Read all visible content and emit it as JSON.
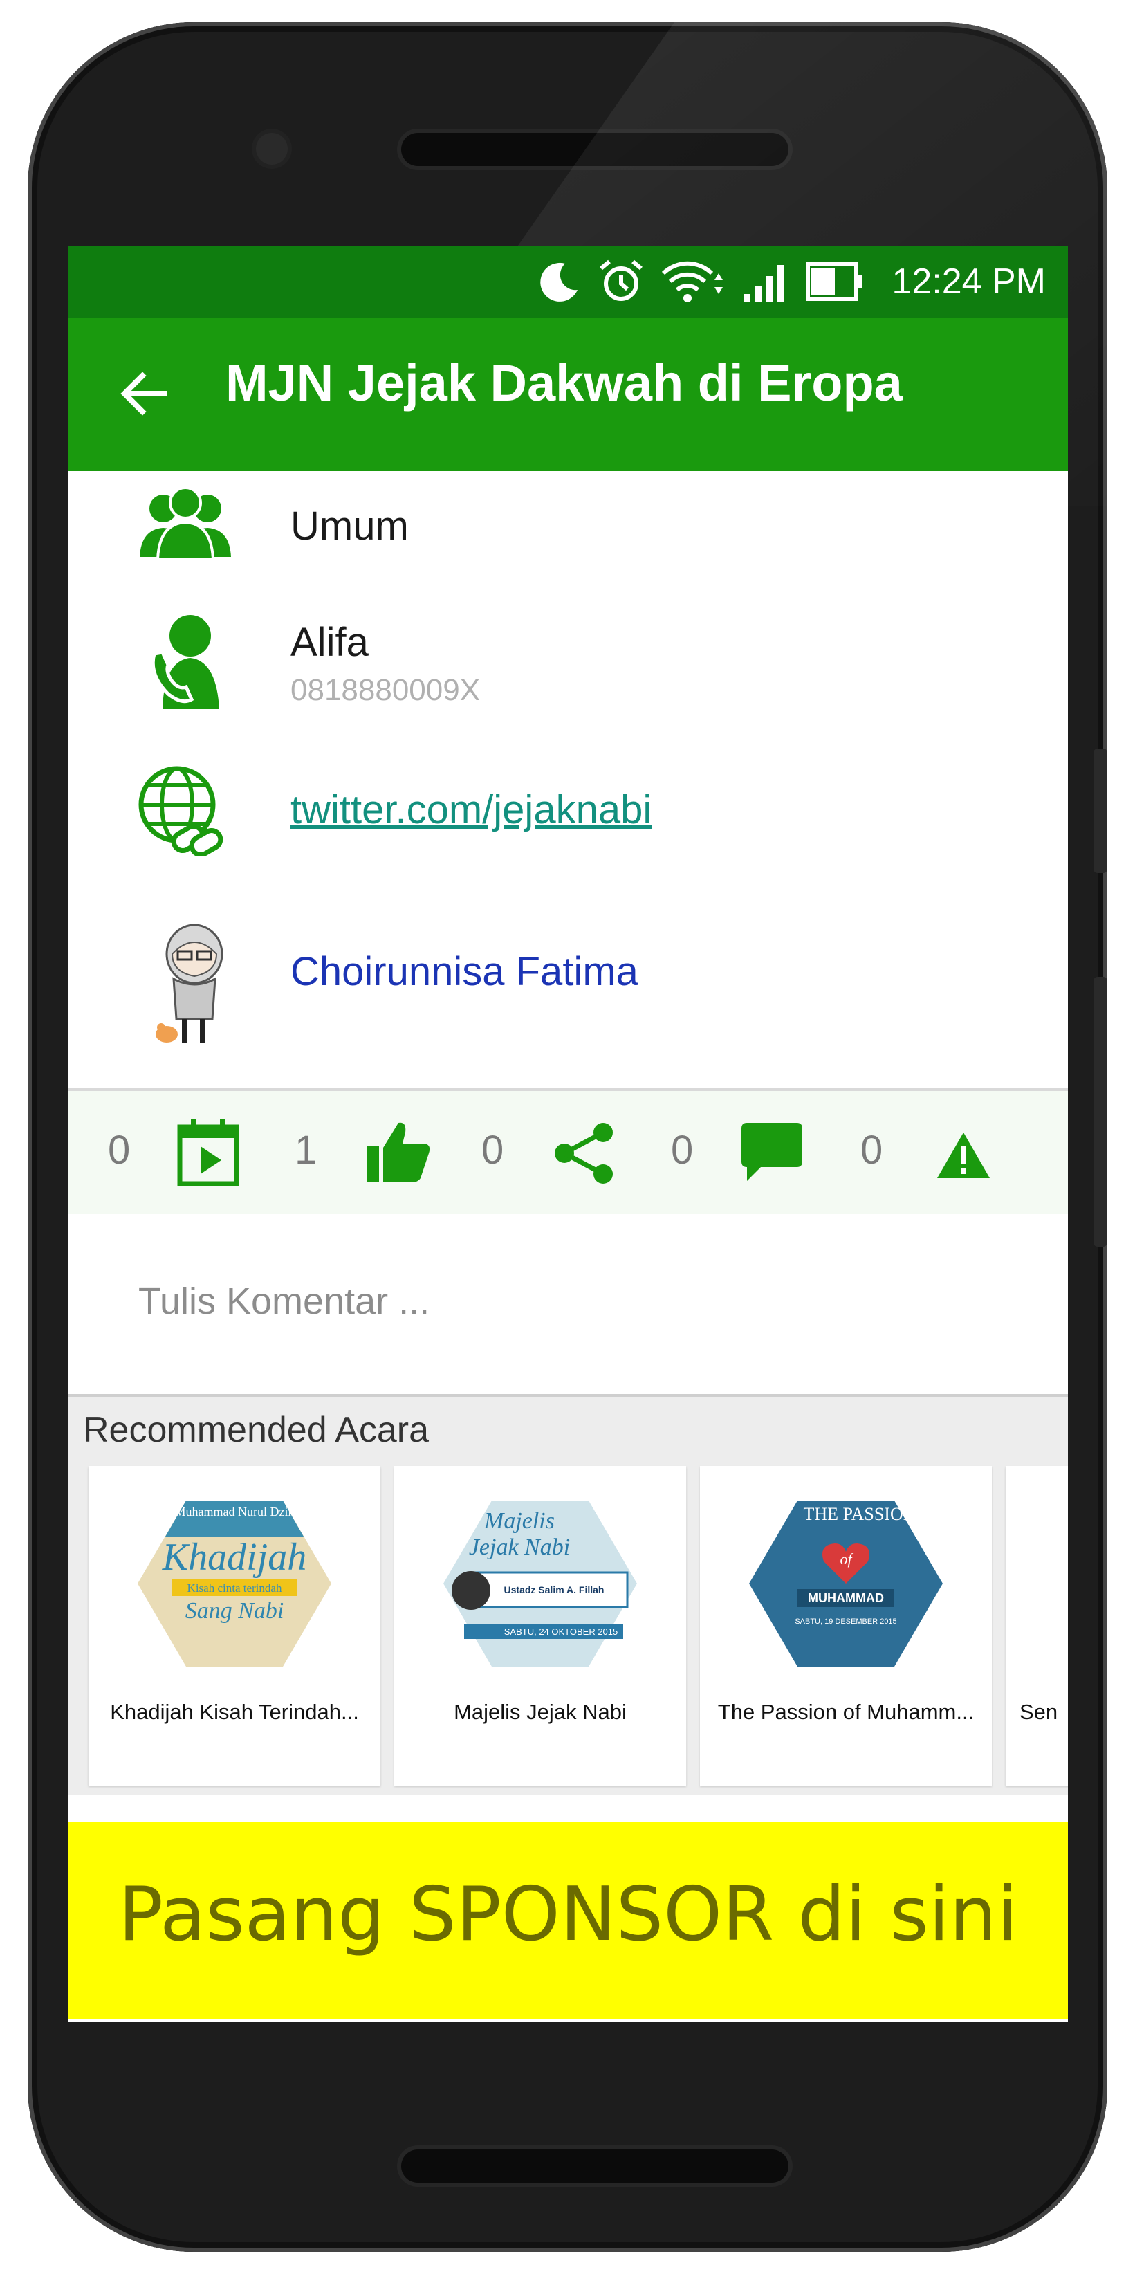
{
  "status_bar": {
    "time": "12:24 PM"
  },
  "toolbar": {
    "title": "MJN Jejak Dakwah di Eropa"
  },
  "info": {
    "category": "Umum",
    "contact_name": "Alifa",
    "contact_phone": "0818880009X",
    "website": "twitter.com/jejaknabi",
    "organizer": "Choirunnisa Fatima"
  },
  "actions": {
    "schedule_count": "0",
    "like_count": "1",
    "share_count": "0",
    "comment_count": "0",
    "report_count": "0"
  },
  "comment": {
    "placeholder": "Tulis Komentar ..."
  },
  "recommended": {
    "title": "Recommended Acara",
    "items": [
      {
        "title": "Khadijah Kisah Terindah...",
        "thumb_lines": [
          "Muhammad Nurul Dzik",
          "Khadijah",
          "Kisah cinta terindah",
          "Sang Nabi"
        ]
      },
      {
        "title": "Majelis Jejak Nabi",
        "thumb_lines": [
          "Majelis",
          "Jejak Nabi",
          "Ustadz Salim A. Fillah",
          "SABTU, 24 OKTOBER 2015"
        ]
      },
      {
        "title": "The Passion of Muhamm...",
        "thumb_lines": [
          "THE PASSION",
          "of",
          "MUHAMMAD",
          "SABTU, 19 DESEMBER 2015"
        ]
      },
      {
        "title": "Sen"
      }
    ]
  },
  "sponsor": {
    "text": "Pasang SPONSOR di sini"
  },
  "colors": {
    "status_bar": "#0f7d0f",
    "toolbar": "#1a9a0e",
    "icon_green": "#1a9a0e",
    "link": "#12907e",
    "person_link": "#1b34b4",
    "sponsor_bg": "#ffff00",
    "sponsor_text": "#6b6b00"
  },
  "icons": [
    "moon-icon",
    "alarm-icon",
    "wifi-icon",
    "signal-icon",
    "battery-icon",
    "back-arrow-icon",
    "group-icon",
    "phone-contact-icon",
    "web-link-icon",
    "avatar",
    "calendar-play-icon",
    "thumb-up-icon",
    "share-icon",
    "chat-bubble-icon",
    "warning-icon"
  ]
}
